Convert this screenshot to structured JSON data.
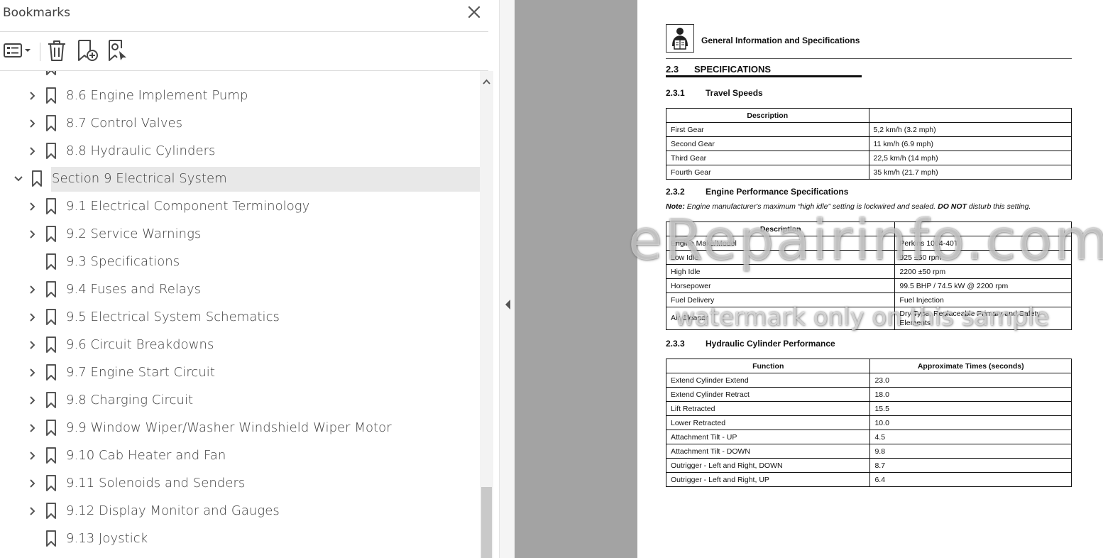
{
  "panel": {
    "title": "Bookmarks"
  },
  "toolbar": {
    "options_icon": "list-options-icon",
    "delete_icon": "trash-icon",
    "add_bookmark_icon": "add-bookmark-icon",
    "find_bookmark_icon": "find-bookmark-icon"
  },
  "tree": [
    {
      "label": "8.6 Engine Implement Pump",
      "level": 1,
      "expandable": true,
      "expanded": false
    },
    {
      "label": "8.7 Control Valves",
      "level": 1,
      "expandable": true,
      "expanded": false
    },
    {
      "label": "8.8 Hydraulic Cylinders",
      "level": 1,
      "expandable": true,
      "expanded": false
    },
    {
      "label": "Section 9 Electrical System",
      "level": 0,
      "expandable": true,
      "expanded": true,
      "selected": true
    },
    {
      "label": "9.1 Electrical Component Terminology",
      "level": 1,
      "expandable": true,
      "expanded": false
    },
    {
      "label": "9.2 Service Warnings",
      "level": 1,
      "expandable": true,
      "expanded": false
    },
    {
      "label": "9.3 Specifications",
      "level": 1,
      "expandable": false,
      "expanded": false
    },
    {
      "label": "9.4 Fuses and Relays",
      "level": 1,
      "expandable": true,
      "expanded": false
    },
    {
      "label": "9.5 Electrical System Schematics",
      "level": 1,
      "expandable": true,
      "expanded": false
    },
    {
      "label": "9.6 Circuit Breakdowns",
      "level": 1,
      "expandable": true,
      "expanded": false
    },
    {
      "label": "9.7 Engine Start Circuit",
      "level": 1,
      "expandable": true,
      "expanded": false
    },
    {
      "label": "9.8 Charging Circuit",
      "level": 1,
      "expandable": true,
      "expanded": false
    },
    {
      "label": "9.9 Window Wiper/Washer Windshield Wiper Motor",
      "level": 1,
      "expandable": true,
      "expanded": false
    },
    {
      "label": "9.10 Cab Heater and Fan",
      "level": 1,
      "expandable": true,
      "expanded": false
    },
    {
      "label": "9.11 Solenoids and Senders",
      "level": 1,
      "expandable": true,
      "expanded": false
    },
    {
      "label": "9.12 Display Monitor and Gauges",
      "level": 1,
      "expandable": true,
      "expanded": false
    },
    {
      "label": "9.13 Joystick",
      "level": 1,
      "expandable": false,
      "expanded": false
    }
  ],
  "document": {
    "header": "General Information and Specifications",
    "section": {
      "num": "2.3",
      "title": "SPECIFICATIONS"
    },
    "travel": {
      "num": "2.3.1",
      "title": "Travel Speeds",
      "head": [
        "Description",
        ""
      ],
      "rows": [
        [
          "First Gear",
          "5,2 km/h (3.2 mph)"
        ],
        [
          "Second Gear",
          "11 km/h (6.9 mph)"
        ],
        [
          "Third Gear",
          "22,5 km/h (14 mph)"
        ],
        [
          "Fourth Gear",
          "35 km/h (21.7 mph)"
        ]
      ]
    },
    "engine": {
      "num": "2.3.2",
      "title": "Engine Performance Specifications",
      "note_label": "Note:",
      "note_text": "Engine manufacturer's maximum “high idle” setting is lockwired and sealed.",
      "note_bold": "DO NOT",
      "note_tail": "disturb this setting.",
      "head": [
        "Description",
        ""
      ],
      "rows": [
        [
          "Engine Make/Model",
          "Perkins 1004-40T"
        ],
        [
          "Low Idle",
          "925 ±50 rpm"
        ],
        [
          "High Idle",
          "2200 ±50 rpm"
        ],
        [
          "Horsepower",
          "99.5 BHP / 74.5 kW @ 2200 rpm"
        ],
        [
          "Fuel Delivery",
          "Fuel Injection"
        ],
        [
          "Air Cleaner",
          "Dry Type, Replaceable Primary and Safety Elements"
        ]
      ]
    },
    "hydraulic": {
      "num": "2.3.3",
      "title": "Hydraulic Cylinder Performance",
      "head": [
        "Function",
        "Approximate Times (seconds)"
      ],
      "rows": [
        [
          "Extend Cylinder Extend",
          "23.0"
        ],
        [
          "Extend Cylinder Retract",
          "18.0"
        ],
        [
          "Lift Retracted",
          "15.5"
        ],
        [
          "Lower Retracted",
          "10.0"
        ],
        [
          "Attachment Tilt - UP",
          "4.5"
        ],
        [
          "Attachment Tilt - DOWN",
          "9.8"
        ],
        [
          "Outrigger - Left and Right, DOWN",
          "8.7"
        ],
        [
          "Outrigger - Left and Right, UP",
          "6.4"
        ]
      ]
    }
  },
  "watermark": {
    "line1": "eRepairinfo.com",
    "line2": "watermark only on this sample"
  },
  "colors": {
    "selected_row": "#e8e8e8",
    "viewer_bg": "#a3a3a3",
    "icon": "#4a4a4a"
  }
}
